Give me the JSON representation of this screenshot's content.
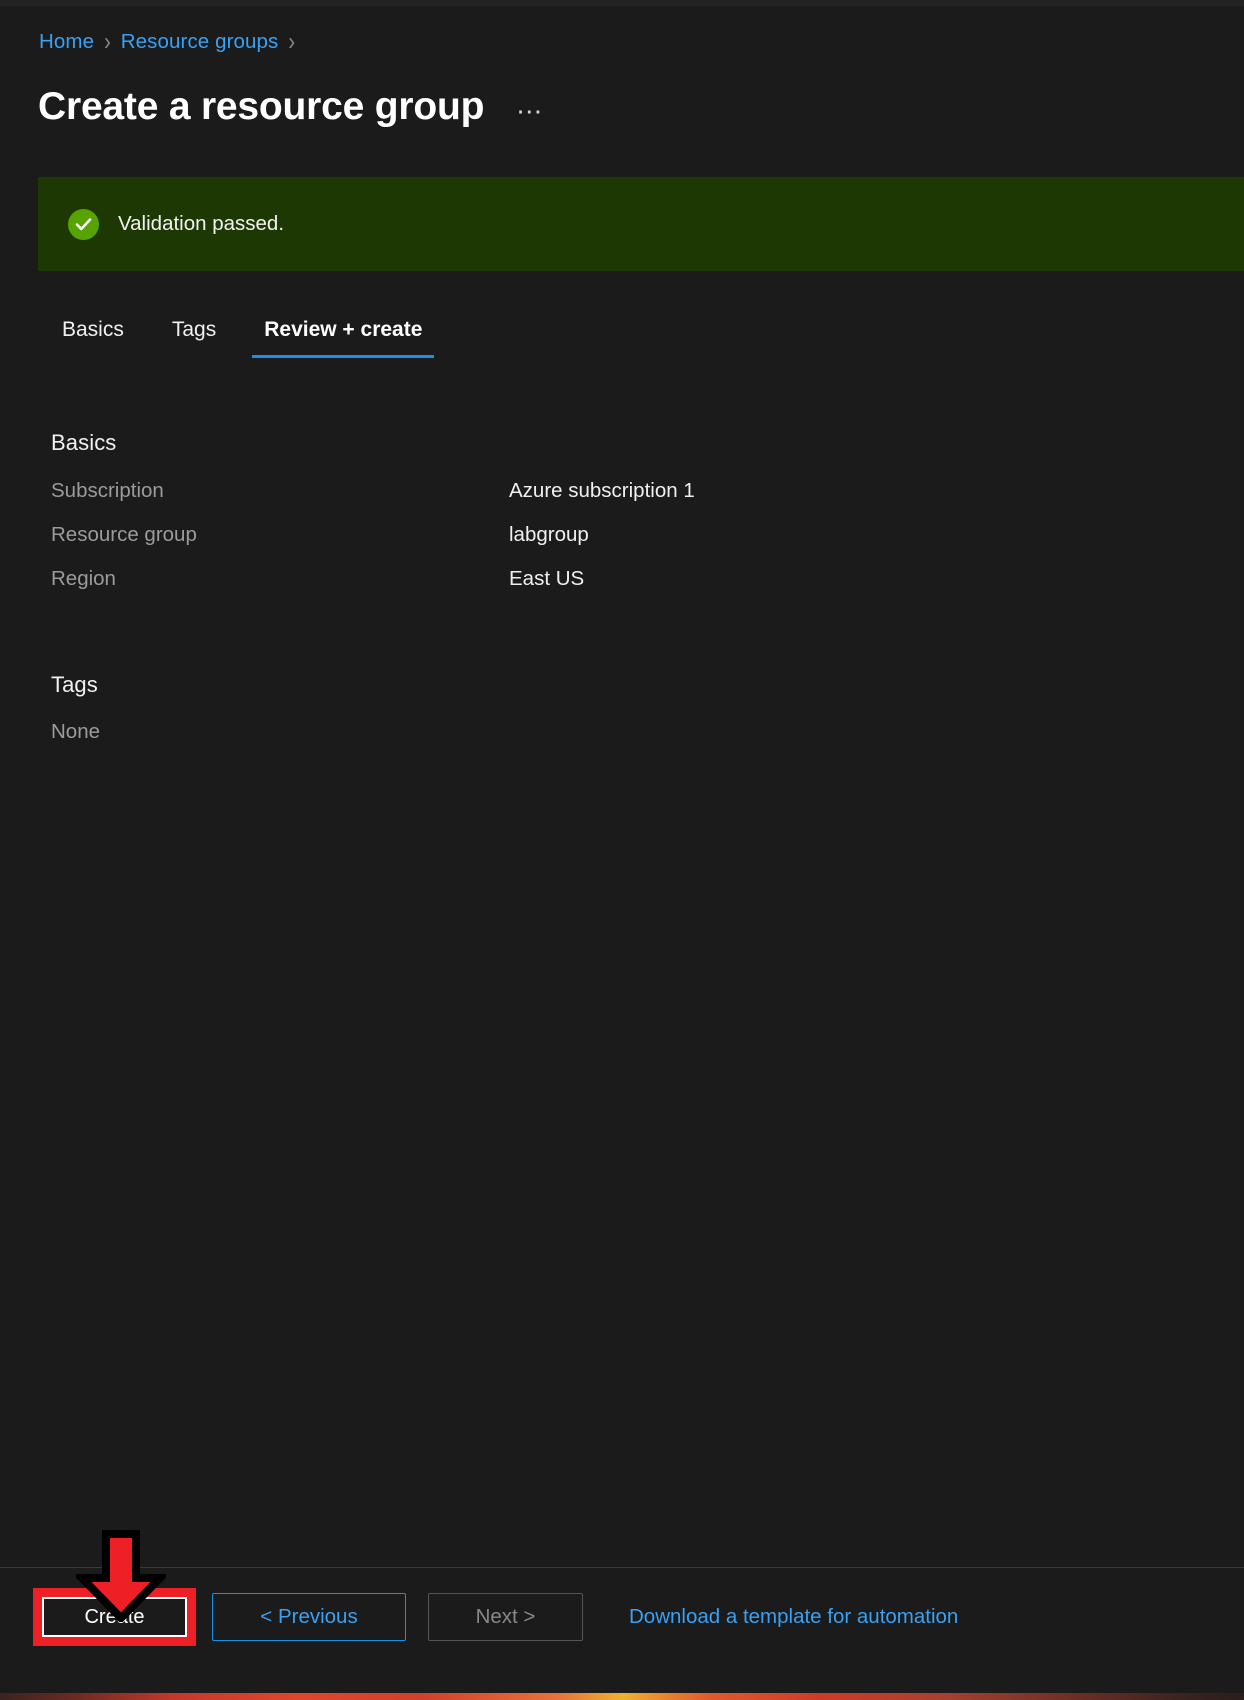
{
  "breadcrumb": {
    "items": [
      {
        "label": "Home"
      },
      {
        "label": "Resource groups"
      }
    ],
    "separator": "›"
  },
  "header": {
    "title": "Create a resource group",
    "more_label": "⋯"
  },
  "banner": {
    "icon": "check-circle-icon",
    "text": "Validation passed.",
    "background_color": "#1e3804",
    "icon_color": "#57a300"
  },
  "tabs": [
    {
      "label": "Basics",
      "active": false
    },
    {
      "label": "Tags",
      "active": false
    },
    {
      "label": "Review + create",
      "active": true
    }
  ],
  "review": {
    "basics": {
      "section_title": "Basics",
      "rows": [
        {
          "key": "Subscription",
          "value": "Azure subscription 1"
        },
        {
          "key": "Resource group",
          "value": "labgroup"
        },
        {
          "key": "Region",
          "value": "East US"
        }
      ]
    },
    "tags": {
      "section_title": "Tags",
      "empty_text": "None"
    }
  },
  "footer": {
    "create_label": "Create",
    "previous_label": "< Previous",
    "next_label": "Next >",
    "download_link_label": "Download a template for automation"
  },
  "annotation": {
    "arrow_color": "#ee2026",
    "arrow_outline_color": "#000000",
    "highlight_color": "#ee2026"
  },
  "colors": {
    "page_background": "#1b1b1b",
    "link": "#3aa0f3",
    "accent": "#1a8fe3",
    "muted_text": "#9b9b9b",
    "primary_text": "#f1f1f1"
  }
}
